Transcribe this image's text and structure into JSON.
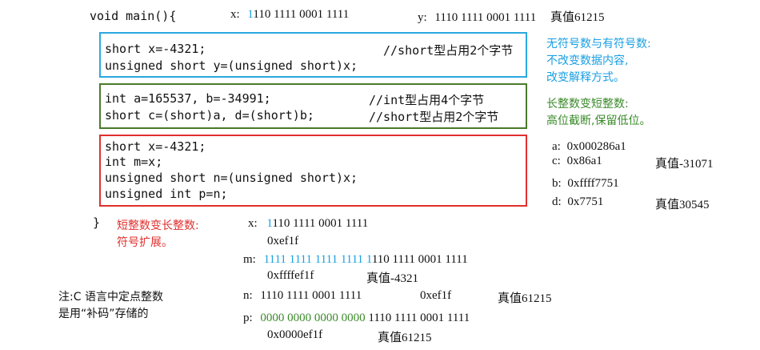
{
  "main_open": "void main(){",
  "main_close": "}",
  "top": {
    "x_label": "x:",
    "x_first_bit": "1",
    "x_bits_rest": "110 1111 0001 1111",
    "y_label": "y:",
    "y_bits": "1110 1111 0001 1111",
    "y_true_value": "真值61215"
  },
  "blue_box": {
    "line1_code": "short x=-4321;",
    "line1_comment": "//short型占用2个字节",
    "line2_code": "unsigned short y=(unsigned short)x;"
  },
  "green_box": {
    "line1_code": "int a=165537, b=-34991;",
    "line1_comment": "//int型占用4个字节",
    "line2_code": "short c=(short)a, d=(short)b;",
    "line2_comment": "//short型占用2个字节"
  },
  "red_box": {
    "line1": "short x=-4321;",
    "line2": "int m=x;",
    "line3": "unsigned short n=(unsigned short)x;",
    "line4": "unsigned int p=n;"
  },
  "notes": {
    "blue_1": "无符号数与有符号数:",
    "blue_2": "不改变数据内容,",
    "blue_3": "改变解释方式。",
    "green_1": "长整数变短整数:",
    "green_2": "高位截断,保留低位。",
    "red_1": "短整数变长整数:",
    "red_2": "符号扩展。",
    "black_1": "注:C 语言中定点整数",
    "black_2": "是用“补码”存储的"
  },
  "right_values": {
    "a_label": "a:",
    "a_value": "0x000286a1",
    "c_label": "c:",
    "c_value": "0x86a1",
    "c_true": "真值-31071",
    "b_label": "b:",
    "b_value": "0xffff7751",
    "d_label": "d:",
    "d_value": "0x7751",
    "d_true": "真值30545"
  },
  "bottom": {
    "x_label": "x:",
    "x_first_bit": "1",
    "x_bits_rest": "110 1111 0001 1111",
    "x_hex": "0xef1f",
    "m_label": "m:",
    "m_ext_bits": "1111 1111 1111 1111 1",
    "m_bits_rest": "110 1111 0001 1111",
    "m_hex": "0xffffef1f",
    "m_true": "真值-4321",
    "n_label": "n:",
    "n_bits": "1110 1111 0001 1111",
    "n_hex": "0xef1f",
    "n_true": "真值61215",
    "p_label": "p:",
    "p_zero_bits": "0000 0000 0000 0000",
    "p_bits_rest": " 1110 1111 0001 1111",
    "p_hex": "0x0000ef1f",
    "p_true": "真值61215"
  },
  "colors": {
    "blue": "#1a9fe3",
    "green": "#3a8a2a",
    "red": "#e0302e"
  }
}
